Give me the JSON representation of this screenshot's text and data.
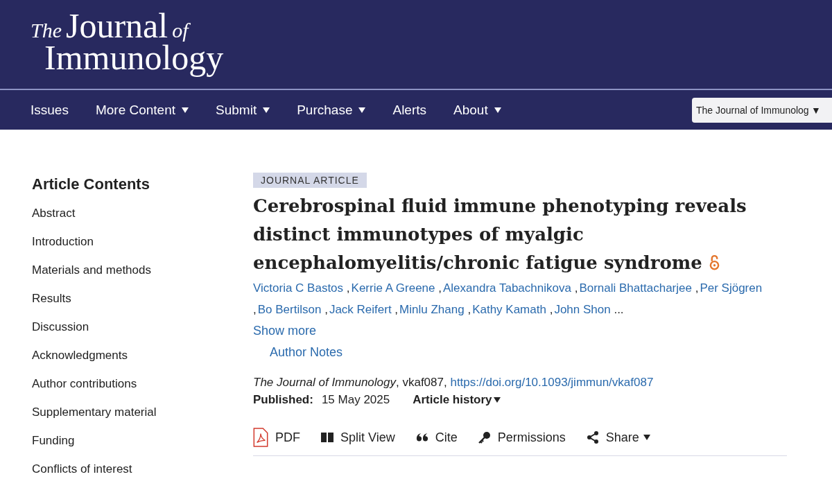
{
  "logo": {
    "prefix": "The",
    "main": "Journal",
    "joiner": "of",
    "name": "Immunology"
  },
  "nav": {
    "items": [
      {
        "label": "Issues",
        "dropdown": false
      },
      {
        "label": "More Content",
        "dropdown": true
      },
      {
        "label": "Submit",
        "dropdown": true
      },
      {
        "label": "Purchase",
        "dropdown": true
      },
      {
        "label": "Alerts",
        "dropdown": false
      },
      {
        "label": "About",
        "dropdown": true
      }
    ],
    "journal_select": {
      "value": "The Journal of Immunolog",
      "arrow": "▼"
    }
  },
  "sidebar": {
    "title": "Article Contents",
    "items": [
      "Abstract",
      "Introduction",
      "Materials and methods",
      "Results",
      "Discussion",
      "Acknowledgments",
      "Author contributions",
      "Supplementary material",
      "Funding",
      "Conflicts of interest"
    ]
  },
  "article": {
    "type_badge": "JOURNAL ARTICLE",
    "title": "Cerebrospinal fluid immune phenotyping reveals distinct immunotypes of myalgic encephalomyelitis/chronic fatigue syndrome",
    "open_access": true,
    "authors": [
      "Victoria C Bastos",
      "Kerrie A Greene",
      "Alexandra Tabachnikova",
      "Bornali Bhattacharjee",
      "Per Sjögren",
      "Bo Bertilson",
      "Jack Reifert",
      "Minlu Zhang",
      "Kathy Kamath",
      "John Shon"
    ],
    "author_separator": ",",
    "authors_ellipsis": "...",
    "show_more": "Show more",
    "author_notes": "Author Notes",
    "journal": "The Journal of Immunology",
    "article_id": ", vkaf087, ",
    "doi": "https://doi.org/10.1093/jimmun/vkaf087",
    "published_label": "Published:",
    "published_date": "15 May 2025",
    "history": {
      "label": "Article history",
      "dropdown": true
    },
    "tools": [
      {
        "kind": "pdf",
        "label": "PDF",
        "dropdown": false
      },
      {
        "kind": "split",
        "label": "Split View",
        "dropdown": false
      },
      {
        "kind": "cite",
        "label": "Cite",
        "dropdown": false
      },
      {
        "kind": "key",
        "label": "Permissions",
        "dropdown": false
      },
      {
        "kind": "share",
        "label": "Share",
        "dropdown": true
      }
    ]
  }
}
